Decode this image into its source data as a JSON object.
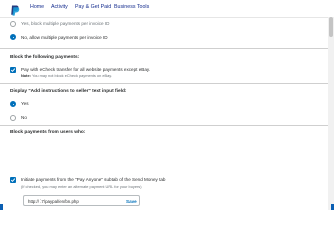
{
  "nav": {
    "items": [
      "Home",
      "Activity",
      "Pay & Get Paid",
      "Business Tools"
    ]
  },
  "invoice_options": {
    "option_block": "Yes, block multiple payments per invoice ID",
    "option_allow": "No, allow multiple payments per invoice ID",
    "selected": "allow"
  },
  "block_following": {
    "heading": "Block the following payments:",
    "echeck_label": "Pay with eCheck transfer for all website payments except eBay.",
    "echeck_note_bold": "Note:",
    "echeck_note": " You may not block eCheck payments on eBay.",
    "echeck_checked": true
  },
  "instructions_field": {
    "heading": "Display \"Add instructions to seller\" text input field:",
    "option_yes": "Yes",
    "option_no": "No",
    "selected": "yes"
  },
  "block_users": {
    "heading": "Block payments from users who:",
    "label": "Initiate payments from the \"Pay Anyone\" subtab of the Send Money tab",
    "sub": "(If checked, you may enter an alternate payment URL for your buyers)",
    "checked": true,
    "url_value": "http://           ̇.7/paypal/en/bn.php",
    "save_label": "Save"
  },
  "colors": {
    "accent": "#0070ba",
    "nav_text": "#142c8e"
  }
}
